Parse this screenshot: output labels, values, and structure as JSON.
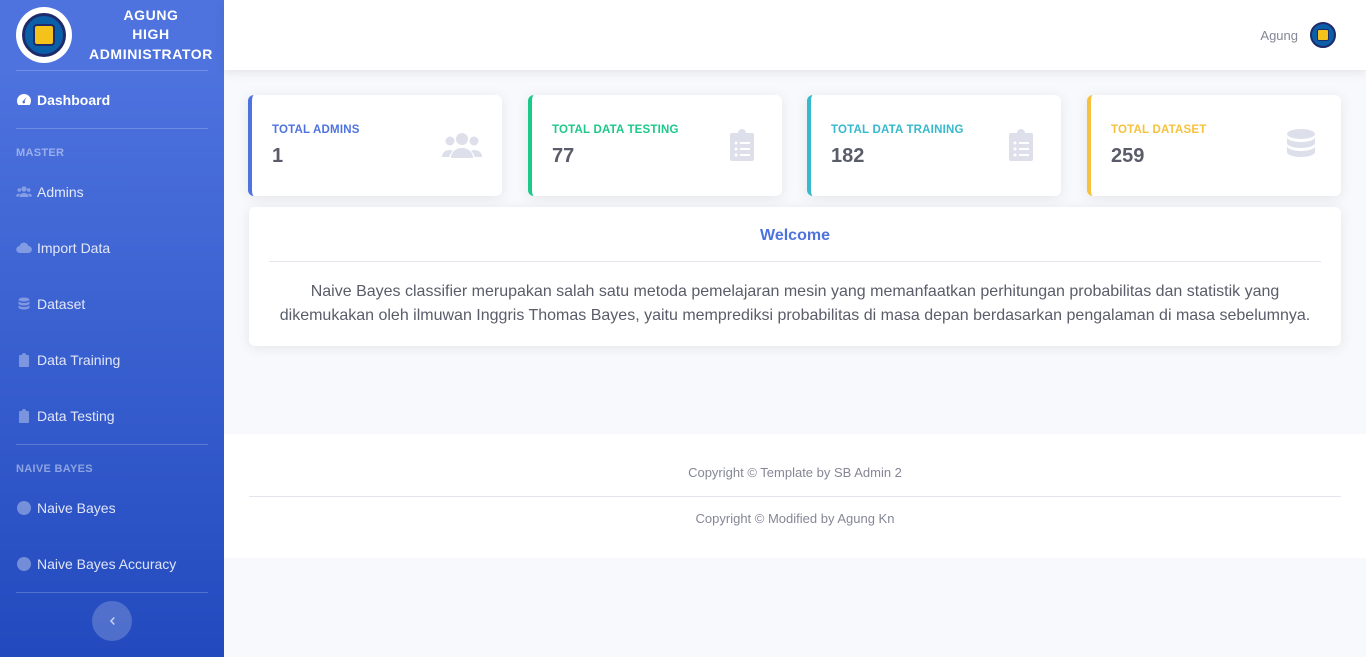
{
  "brand": {
    "line1": "AGUNG",
    "line2": "HIGH",
    "line3": "ADMINISTRATOR"
  },
  "sidebar": {
    "dashboard": "Dashboard",
    "heading_master": "MASTER",
    "master_items": [
      "Admins",
      "Import Data",
      "Dataset",
      "Data Training",
      "Data Testing"
    ],
    "heading_nb": "NAIVE BAYES",
    "nb_items": [
      "Naive Bayes",
      "Naive Bayes Accuracy"
    ]
  },
  "topbar": {
    "user": "Agung"
  },
  "stats": [
    {
      "label": "TOTAL ADMINS",
      "value": "1",
      "color": "#4e73df",
      "icon": "users-icon"
    },
    {
      "label": "TOTAL DATA TESTING",
      "value": "77",
      "color": "#1cc88a",
      "icon": "clipboard-list-icon"
    },
    {
      "label": "TOTAL DATA TRAINING",
      "value": "182",
      "color": "#36b9cc",
      "icon": "clipboard-list-icon"
    },
    {
      "label": "TOTAL DATASET",
      "value": "259",
      "color": "#f6c23e",
      "icon": "database-icon"
    }
  ],
  "welcome": {
    "title": "Welcome",
    "body": "Naive Bayes classifier merupakan salah satu metoda pemelajaran mesin yang memanfaatkan perhitungan probabilitas dan statistik yang dikemukakan oleh ilmuwan Inggris Thomas Bayes, yaitu memprediksi probabilitas di masa depan berdasarkan pengalaman di masa sebelumnya."
  },
  "footer": {
    "line1": "Copyright © Template by SB Admin 2",
    "line2": "Copyright © Modified by Agung Kn"
  }
}
